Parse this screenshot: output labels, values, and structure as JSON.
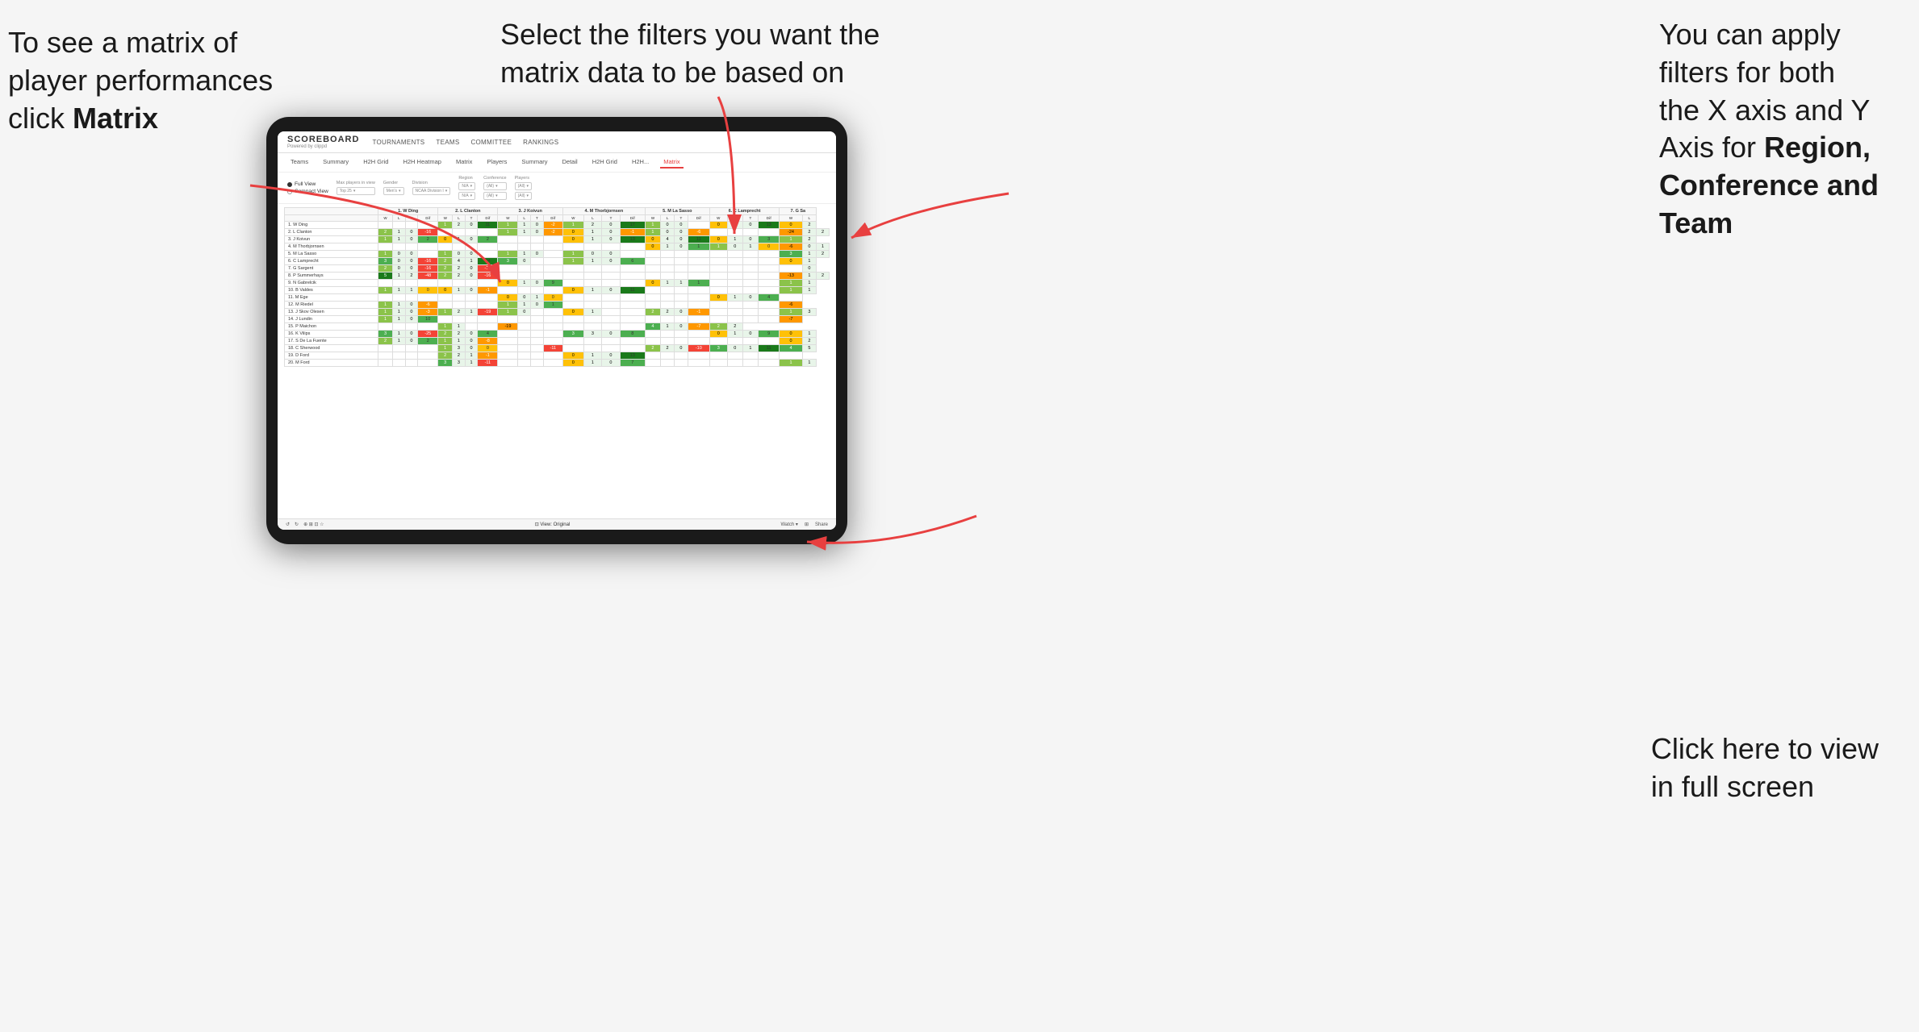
{
  "annotations": {
    "top_left": {
      "line1": "To see a matrix of",
      "line2": "player performances",
      "line3_plain": "click ",
      "line3_bold": "Matrix"
    },
    "top_center": {
      "text": "Select the filters you want the matrix data to be based on"
    },
    "top_right": {
      "line1": "You  can apply",
      "line2": "filters for both",
      "line3": "the X axis and Y",
      "line4_plain": "Axis for ",
      "line4_bold": "Region,",
      "line5_bold": "Conference and",
      "line6_bold": "Team"
    },
    "bottom_right": {
      "line1": "Click here to view",
      "line2": "in full screen"
    }
  },
  "scoreboard": {
    "logo": "SCOREBOARD",
    "logo_sub": "Powered by clippd",
    "nav_items": [
      "TOURNAMENTS",
      "TEAMS",
      "COMMITTEE",
      "RANKINGS"
    ],
    "sub_nav": [
      "Teams",
      "Summary",
      "H2H Grid",
      "H2H Heatmap",
      "Matrix",
      "Players",
      "Summary",
      "Detail",
      "H2H Grid",
      "H2H...",
      "Matrix"
    ],
    "active_nav": "Matrix"
  },
  "filters": {
    "view_options": [
      "Full View",
      "Compact View"
    ],
    "selected_view": "Full View",
    "max_players_label": "Max players in view",
    "max_players_value": "Top 25",
    "gender_label": "Gender",
    "gender_value": "Men's",
    "division_label": "Division",
    "division_value": "NCAA Division I",
    "region_label": "Region",
    "region_value": "N/A",
    "region_value2": "N/A",
    "conference_label": "Conference",
    "conference_value": "(All)",
    "conference_value2": "(All)",
    "players_label": "Players",
    "players_value": "(All)",
    "players_value2": "(All)"
  },
  "matrix": {
    "col_headers": [
      "1. W Ding",
      "2. L Clanton",
      "3. J Koivun",
      "4. M Thorbjornsen",
      "5. M La Sasso",
      "6. C Lamprecht",
      "7. G Sa"
    ],
    "sub_headers": [
      "W",
      "L",
      "T",
      "Dif"
    ],
    "rows": [
      {
        "name": "1. W Ding",
        "cells": [
          "",
          "",
          "",
          "",
          "1",
          "2",
          "0",
          "11",
          "1",
          "1",
          "0",
          "-2",
          "1",
          "2",
          "0",
          "17",
          "1",
          "0",
          "0",
          "",
          "0",
          "1",
          "0",
          "13",
          "0",
          "2"
        ]
      },
      {
        "name": "2. L Clanton",
        "cells": [
          "2",
          "1",
          "0",
          "-16",
          "",
          "",
          "",
          "",
          "1",
          "1",
          "0",
          "-2",
          "0",
          "1",
          "0",
          "-1",
          "1",
          "0",
          "0",
          "-6",
          "",
          "",
          "",
          "",
          "-24",
          "2",
          "2"
        ]
      },
      {
        "name": "3. J Koivun",
        "cells": [
          "1",
          "1",
          "0",
          "2",
          "0",
          "1",
          "0",
          "2",
          "",
          "",
          "",
          "",
          "0",
          "1",
          "0",
          "13",
          "0",
          "4",
          "0",
          "11",
          "0",
          "1",
          "0",
          "3",
          "1",
          "2"
        ]
      },
      {
        "name": "4. M Thorbjornsen",
        "cells": [
          "",
          "",
          "",
          "",
          "",
          "",
          "",
          "",
          "",
          "",
          "",
          "",
          "",
          "",
          "",
          "",
          "0",
          "1",
          "0",
          "1",
          "1",
          "0",
          "1",
          "0",
          "-6",
          "0",
          "1"
        ]
      },
      {
        "name": "5. M La Sasso",
        "cells": [
          "1",
          "0",
          "0",
          "",
          "1",
          "0",
          "0",
          "",
          "1",
          "1",
          "0",
          "",
          "1",
          "0",
          "0",
          "",
          "",
          "",
          "",
          "",
          "",
          "",
          "",
          "",
          "3",
          "1",
          "2"
        ]
      },
      {
        "name": "6. C Lamprecht",
        "cells": [
          "3",
          "0",
          "0",
          "-16",
          "2",
          "4",
          "1",
          "24",
          "3",
          "0",
          "",
          "",
          "1",
          "1",
          "0",
          "6",
          "",
          "",
          "",
          "",
          "",
          "",
          "",
          "",
          "0",
          "1"
        ]
      },
      {
        "name": "7. G Sargent",
        "cells": [
          "2",
          "0",
          "0",
          "-16",
          "2",
          "2",
          "0",
          "-15",
          "",
          "",
          "",
          "",
          "",
          "",
          "",
          "",
          "",
          "",
          "",
          "",
          "",
          "",
          "",
          "",
          "",
          "0"
        ]
      },
      {
        "name": "8. P Summerhays",
        "cells": [
          "5",
          "1",
          "2",
          "-48",
          "2",
          "2",
          "0",
          "-16",
          "",
          "",
          "",
          "",
          "",
          "",
          "",
          "",
          "",
          "",
          "",
          "",
          "",
          "",
          "",
          "",
          "-13",
          "1",
          "2"
        ]
      },
      {
        "name": "9. N Gabrelcik",
        "cells": [
          "",
          "",
          "",
          "",
          "",
          "",
          "",
          "",
          "0",
          "1",
          "0",
          "9",
          "",
          "",
          "",
          "",
          "0",
          "1",
          "1",
          "1",
          "",
          "",
          "",
          "",
          "1",
          "1"
        ]
      },
      {
        "name": "10. B Valdes",
        "cells": [
          "1",
          "1",
          "1",
          "0",
          "0",
          "1",
          "0",
          "-1",
          "",
          "",
          "",
          "",
          "0",
          "1",
          "0",
          "11",
          "",
          "",
          "",
          "",
          "",
          "",
          "",
          "",
          "1",
          "1"
        ]
      },
      {
        "name": "11. M Ege",
        "cells": [
          "",
          "",
          "",
          "",
          "",
          "",
          "",
          "",
          "0",
          "0",
          "1",
          "0",
          "",
          "",
          "",
          "",
          "",
          "",
          "",
          "",
          "0",
          "1",
          "0",
          "4",
          ""
        ]
      },
      {
        "name": "12. M Riedel",
        "cells": [
          "1",
          "1",
          "0",
          "-6",
          "",
          "",
          "",
          "",
          "1",
          "1",
          "0",
          "1",
          "",
          "",
          "",
          "",
          "",
          "",
          "",
          "",
          "",
          "",
          "",
          "",
          "-6"
        ]
      },
      {
        "name": "13. J Skov Olesen",
        "cells": [
          "1",
          "1",
          "0",
          "-3",
          "1",
          "2",
          "1",
          "-19",
          "1",
          "0",
          "",
          "",
          "0",
          "1",
          "",
          "",
          "2",
          "2",
          "0",
          "-1",
          "",
          "",
          "",
          "",
          "1",
          "3"
        ]
      },
      {
        "name": "14. J Lundin",
        "cells": [
          "1",
          "1",
          "0",
          "10",
          "",
          "",
          "",
          "",
          "",
          "",
          "",
          "",
          "",
          "",
          "",
          "",
          "",
          "",
          "",
          "",
          "",
          "",
          "",
          "",
          "-7"
        ]
      },
      {
        "name": "15. P Maichon",
        "cells": [
          "",
          "",
          "",
          "",
          "1",
          "1",
          "",
          "",
          "-19",
          "",
          "",
          "",
          "",
          "",
          "",
          "",
          "4",
          "1",
          "0",
          "-7",
          "2",
          "2"
        ]
      },
      {
        "name": "16. K Vilips",
        "cells": [
          "3",
          "1",
          "0",
          "-25",
          "2",
          "2",
          "0",
          "4",
          "",
          "",
          "",
          "",
          "3",
          "3",
          "0",
          "8",
          "",
          "",
          "",
          "",
          "0",
          "1",
          "0",
          "9",
          "0",
          "1"
        ]
      },
      {
        "name": "17. S De La Fuente",
        "cells": [
          "2",
          "1",
          "0",
          "2",
          "1",
          "1",
          "0",
          "-8",
          "",
          "",
          "",
          "",
          "",
          "",
          "",
          "",
          "",
          "",
          "",
          "",
          "",
          "",
          "",
          "",
          "0",
          "2"
        ]
      },
      {
        "name": "18. C Sherwood",
        "cells": [
          "",
          "",
          "",
          "",
          "1",
          "3",
          "0",
          "0",
          "",
          "",
          "",
          "-11",
          "",
          "",
          "",
          "",
          "2",
          "2",
          "0",
          "-10",
          "3",
          "0",
          "1",
          "11",
          "4",
          "5"
        ]
      },
      {
        "name": "19. D Ford",
        "cells": [
          "",
          "",
          "",
          "",
          "2",
          "2",
          "1",
          "-1",
          "",
          "",
          "",
          "",
          "0",
          "1",
          "0",
          "13",
          "",
          "",
          "",
          "",
          "",
          "",
          "",
          "",
          ""
        ]
      },
      {
        "name": "20. M Ford",
        "cells": [
          "",
          "",
          "",
          "",
          "3",
          "3",
          "1",
          "-11",
          "",
          "",
          "",
          "",
          "0",
          "1",
          "0",
          "7",
          "",
          "",
          "",
          "",
          "",
          "",
          "",
          "",
          "1",
          "1"
        ]
      }
    ]
  },
  "toolbar": {
    "undo_label": "↺",
    "redo_label": "↻",
    "view_label": "View: Original",
    "watch_label": "Watch ▾",
    "share_label": "Share"
  },
  "colors": {
    "brand_red": "#e84040",
    "arrow_color": "#e84040",
    "green_dark": "#1a7a1a",
    "green": "#4caf50",
    "yellow": "#ffc107",
    "gray": "#e0e0e0"
  }
}
